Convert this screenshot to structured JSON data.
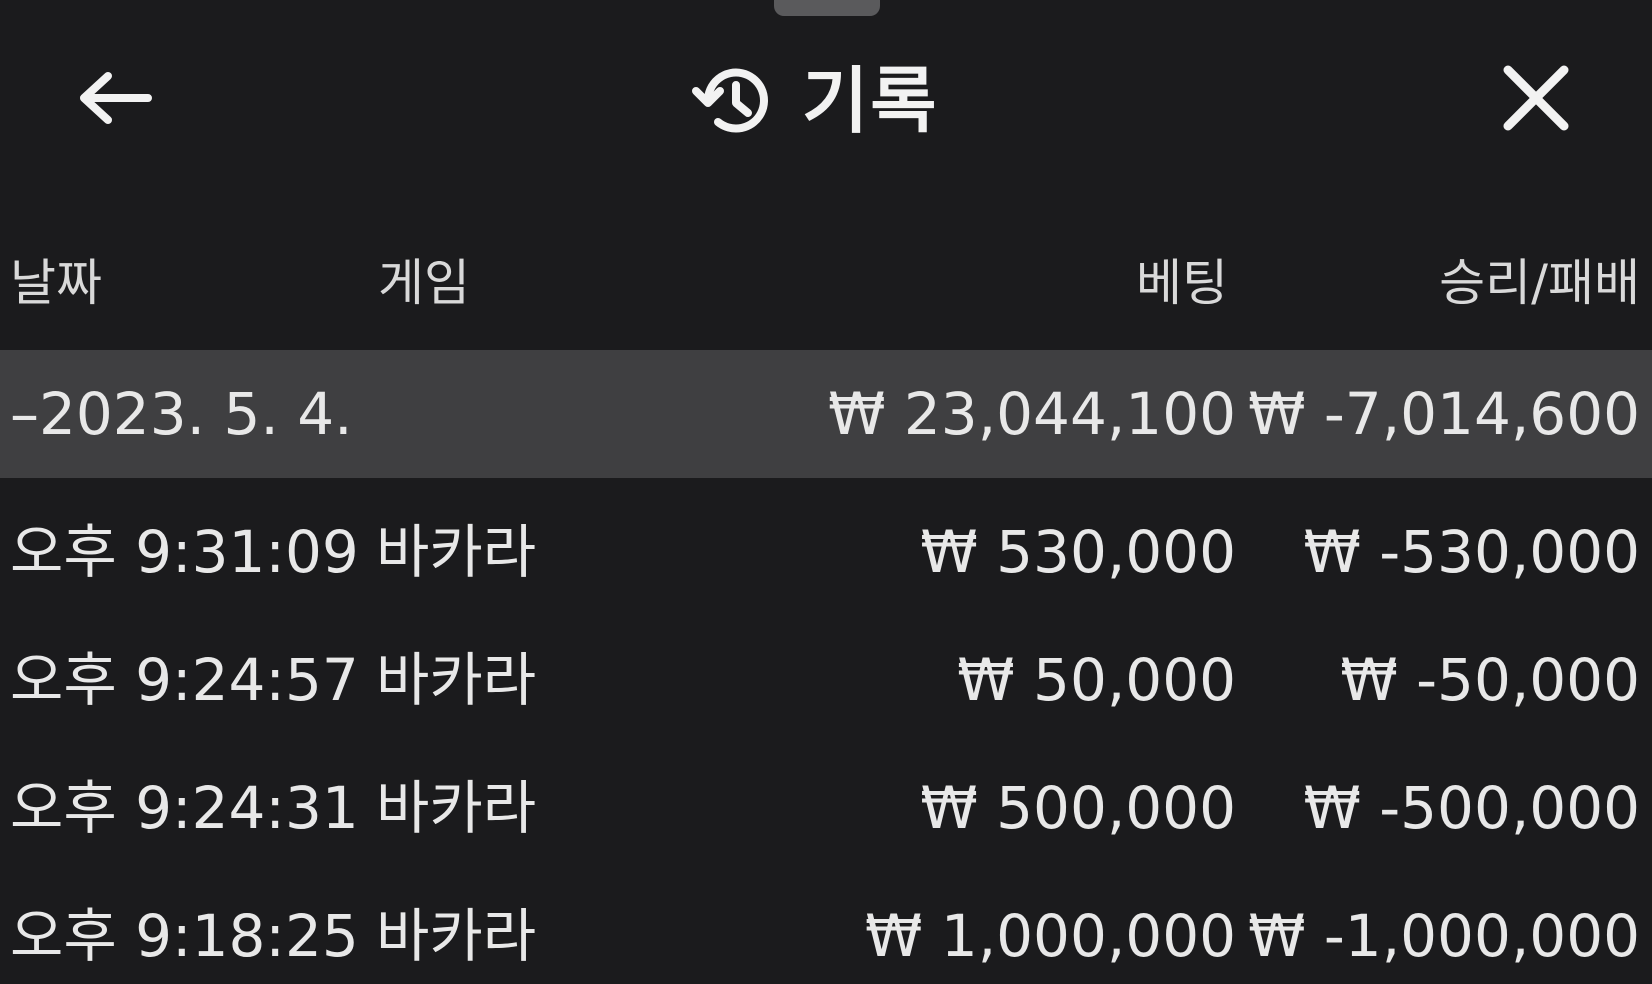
{
  "header": {
    "title": "기록",
    "back_icon": "arrow-left-icon",
    "history_icon": "history-icon",
    "close_icon": "close-icon"
  },
  "columns": {
    "date": "날짜",
    "game": "게임",
    "bet": "베팅",
    "result": "승리/패배"
  },
  "summary": {
    "date": "–2023. 5. 4.",
    "bet": "₩ 23,044,100",
    "result": "₩ -7,014,600"
  },
  "rows": [
    {
      "time": "오후 9:31:09",
      "game": "바카라",
      "bet": "₩ 530,000",
      "result": "₩ -530,000"
    },
    {
      "time": "오후 9:24:57",
      "game": "바카라",
      "bet": "₩ 50,000",
      "result": "₩ -50,000"
    },
    {
      "time": "오후 9:24:31",
      "game": "바카라",
      "bet": "₩ 500,000",
      "result": "₩ -500,000"
    },
    {
      "time": "오후 9:18:25",
      "game": "바카라",
      "bet": "₩ 1,000,000",
      "result": "₩ -1,000,000"
    }
  ],
  "colors": {
    "background": "#1b1b1d",
    "summary_background": "#3f3f41",
    "text": "#e8e8e8"
  }
}
